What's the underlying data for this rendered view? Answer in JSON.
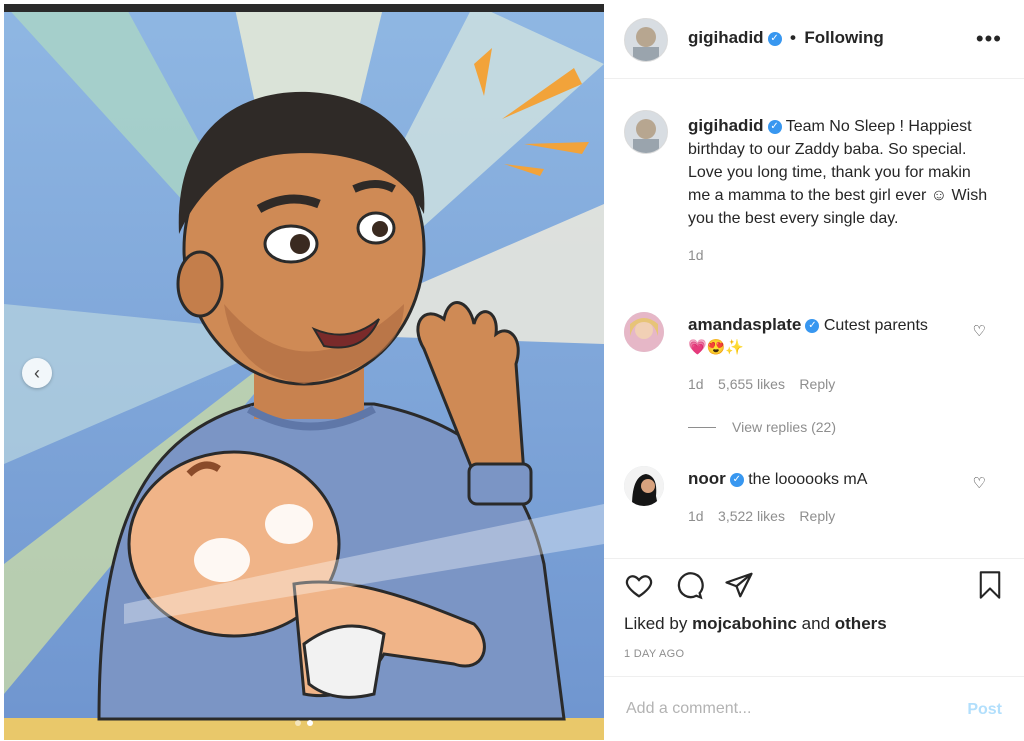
{
  "header": {
    "username": "gigihadid",
    "separator": "•",
    "follow_state": "Following",
    "more_label": "•••"
  },
  "caption": {
    "username": "gigihadid",
    "text": "Team No Sleep ! Happiest birthday to our Zaddy baba. So special. Love you long time, thank you for makin me a mamma to the best girl ever ☺ Wish you the best every single day.",
    "age": "1d"
  },
  "comments": [
    {
      "username": "amandasplate",
      "text": "Cutest parents",
      "emoji": "💗😍✨",
      "age": "1d",
      "likes": "5,655 likes",
      "reply_label": "Reply",
      "view_replies": "View replies (22)"
    },
    {
      "username": "noor",
      "text": "the loooooks mA",
      "age": "1d",
      "likes": "3,522 likes",
      "reply_label": "Reply"
    }
  ],
  "likes_line": {
    "prefix": "Liked by",
    "user": "mojcabohinc",
    "conj": "and",
    "others": "others"
  },
  "timestamp": "1 DAY AGO",
  "add_comment": {
    "placeholder": "Add a comment...",
    "post_label": "Post"
  },
  "carousel": {
    "prev_icon": "chevron-left-icon",
    "current_index": 2,
    "total": 2
  },
  "colors": {
    "verified": "#3897f0",
    "post_disabled": "#b2dffc",
    "meta": "#8e8e8e"
  }
}
